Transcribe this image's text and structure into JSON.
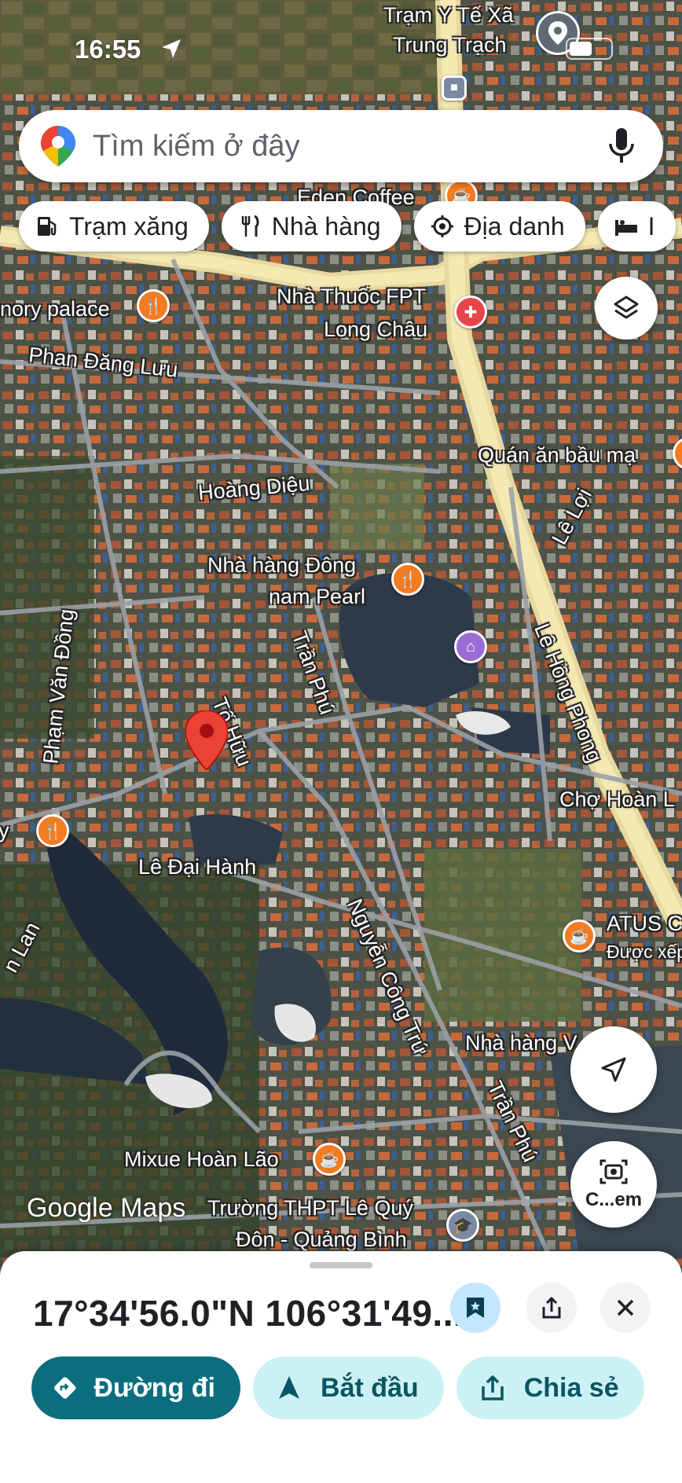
{
  "status_bar": {
    "time": "16:55"
  },
  "search": {
    "placeholder": "Tìm kiếm ở đây"
  },
  "chips": [
    {
      "label": "Trạm xăng",
      "icon": "gas-station-icon"
    },
    {
      "label": "Nhà hàng",
      "icon": "restaurant-icon"
    },
    {
      "label": "Địa danh",
      "icon": "landmark-icon"
    },
    {
      "label": "I",
      "icon": "hotel-icon"
    }
  ],
  "map": {
    "labels": {
      "tram_y_te_1": "Trạm Y Tế Xã",
      "tram_y_te_2": "Trung Trạch",
      "eden_coffee": "Eden Coffee",
      "memory_palace": "nory palace",
      "phan_dang_luu": "Phan Đăng Lưu",
      "nha_thuoc_1": "Nhà Thuốc FPT",
      "nha_thuoc_2": "Long Châu",
      "quan_an": "Quán ăn bầu mạ",
      "hoang_dieu": "Hoàng Diệu",
      "le_loi": "Lê Lợi",
      "nha_hang_dong_1": "Nhà hàng Đông",
      "nha_hang_dong_2": "nam Pearl",
      "le_hong_phong": "Lê Hồng Phong",
      "pham_van_dong": "Phạm Văn Đồng",
      "tran_phu_1": "Trần Phú",
      "to_huu": "Tố Hữu",
      "cho_hoan": "Chợ Hoàn L",
      "le_dai_hanh": "Lê Đại Hành",
      "y_label": "y",
      "n_lan": "n Lan",
      "nguyen_cong_tru": "Nguyễn Công Trứ",
      "atus_1": "ATUS C",
      "atus_2": "Được xếp",
      "nha_hang_v": "Nhà hàng V... ồng",
      "tran_phu_2": "Trần Phú",
      "mixue": "Mixue Hoàn Lão",
      "truong_1": "Trường THPT Lê Quý",
      "truong_2": "Đôn - Quảng Bình"
    },
    "watermark": "Google Maps"
  },
  "camera_button": {
    "label": "C...em"
  },
  "sheet": {
    "coordinates": "17°34'56.0\"N 106°31'49...",
    "actions": [
      {
        "label": "Đường đi",
        "icon": "directions-icon"
      },
      {
        "label": "Bắt đầu",
        "icon": "navigation-arrow-icon"
      },
      {
        "label": "Chia sẻ",
        "icon": "share-icon"
      }
    ]
  },
  "colors": {
    "teal_primary": "#0b6e7f",
    "teal_light": "#ccf1f5",
    "save_blue": "#c2e7ff",
    "pin_red": "#ea4335",
    "poi_orange": "#f47b20"
  }
}
